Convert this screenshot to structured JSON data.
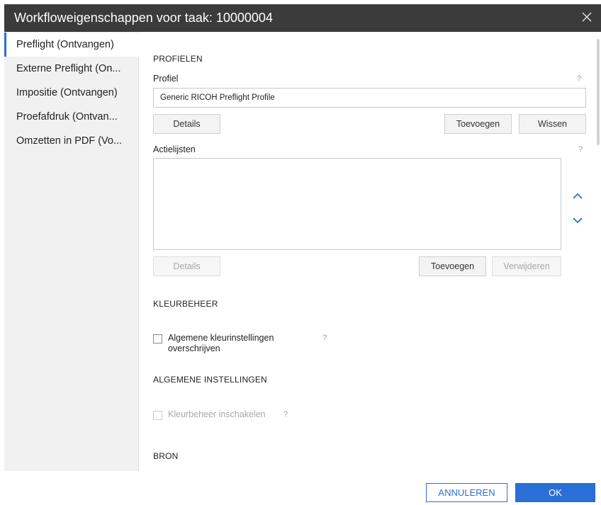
{
  "dialog": {
    "title": "Workfloweigenschappen voor taak: 10000004",
    "close_icon": "close-icon"
  },
  "sidebar": {
    "items": [
      {
        "label": "Preflight (Ontvangen)",
        "active": true
      },
      {
        "label": "Externe Preflight (On..."
      },
      {
        "label": "Impositie (Ontvangen)"
      },
      {
        "label": "Proefafdruk (Ontvan..."
      },
      {
        "label": "Omzetten in PDF (Vo..."
      }
    ]
  },
  "profielen": {
    "heading": "PROFIELEN",
    "profiel_label": "Profiel",
    "profiel_help": "?",
    "profiel_value": "Generic RICOH Preflight Profile",
    "details_label": "Details",
    "toevoegen_label": "Toevoegen",
    "wissen_label": "Wissen",
    "actielijsten_label": "Actielijsten",
    "actielijsten_help": "?",
    "list_details_label": "Details",
    "list_toevoegen_label": "Toevoegen",
    "list_verwijderen_label": "Verwijderen",
    "move_up_icon": "chevron-up-icon",
    "move_down_icon": "chevron-down-icon"
  },
  "kleurbeheer": {
    "heading": "KLEURBEHEER",
    "override_label_line1": "Algemene kleurinstellingen",
    "override_label_line2": "overschrijven",
    "override_help": "?",
    "override_checked": false
  },
  "algemene": {
    "heading": "ALGEMENE INSTELLINGEN",
    "enable_label": "Kleurbeheer inschakelen",
    "enable_help": "?",
    "enable_checked": false,
    "enable_disabled": true
  },
  "bron": {
    "heading": "BRON"
  },
  "footer": {
    "cancel_label": "ANNULEREN",
    "ok_label": "OK"
  },
  "colors": {
    "accent": "#2a6fd6",
    "titlebar": "#3b3b3b",
    "sidebar_bg": "#f1f1f1"
  }
}
